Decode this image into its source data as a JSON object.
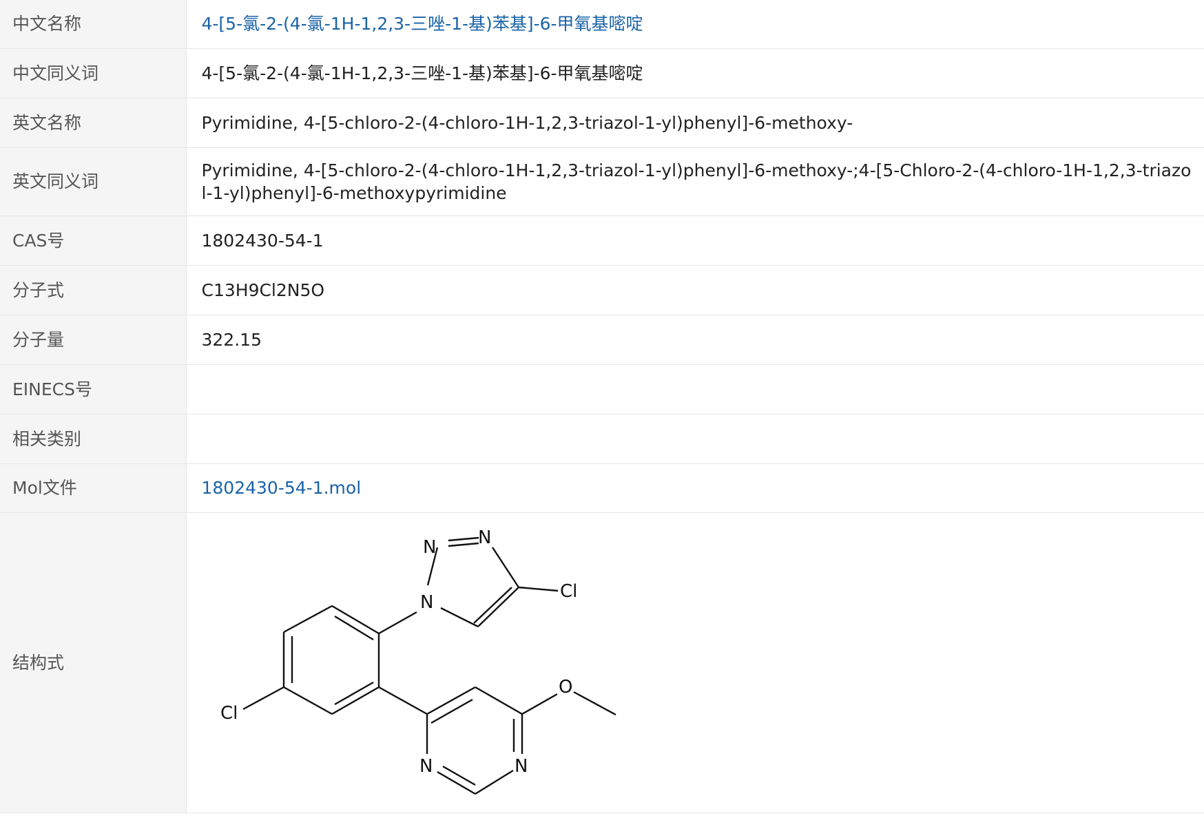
{
  "rows": [
    {
      "label": "中文名称",
      "value": "4-[5-氯-2-(4-氯-1H-1,2,3-三唑-1-基)苯基]-6-甲氧基嘧啶"
    },
    {
      "label": "中文同义词",
      "value": "4-[5-氯-2-(4-氯-1H-1,2,3-三唑-1-基)苯基]-6-甲氧基嘧啶"
    },
    {
      "label": "英文名称",
      "value": "Pyrimidine, 4-[5-chloro-2-(4-chloro-1H-1,2,3-triazol-1-yl)phenyl]-6-methoxy-"
    },
    {
      "label": "英文同义词",
      "value": "Pyrimidine, 4-[5-chloro-2-(4-chloro-1H-1,2,3-triazol-1-yl)phenyl]-6-methoxy-;4-[5-Chloro-2-(4-chloro-1H-1,2,3-triazol-1-yl)phenyl]-6-methoxypyrimidine"
    },
    {
      "label": "CAS号",
      "value": "1802430-54-1"
    },
    {
      "label": "分子式",
      "value": "C13H9Cl2N5O"
    },
    {
      "label": "分子量",
      "value": "322.15"
    },
    {
      "label": "EINECS号",
      "value": ""
    },
    {
      "label": "相关类别",
      "value": ""
    },
    {
      "label": "Mol文件",
      "value": "1802430-54-1.mol"
    },
    {
      "label": "结构式",
      "value": ""
    }
  ],
  "structure": {
    "atoms": {
      "n_top": "N",
      "n_top_right": "N",
      "n_triazole": "N",
      "cl_triazole": "Cl",
      "cl_phenyl": "Cl",
      "o_methoxy": "O",
      "n_pyr_left": "N",
      "n_pyr_right": "N"
    }
  },
  "colors": {
    "link": "#1a63a8",
    "label_bg": "#f5f5f5",
    "border": "#e6e6e6"
  }
}
